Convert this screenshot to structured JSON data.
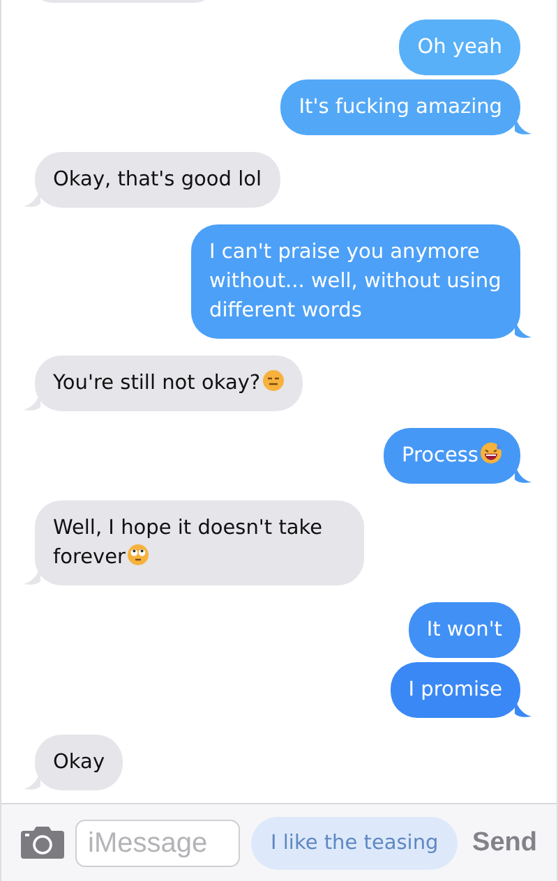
{
  "messages": [
    {
      "kind": "cut-off"
    },
    {
      "kind": "sent",
      "text": "Oh yeah",
      "tail": false
    },
    {
      "kind": "sent",
      "text": "It's fucking amazing",
      "tail": true
    },
    {
      "kind": "received",
      "text": "Okay, that's good lol",
      "tail": true
    },
    {
      "kind": "sent",
      "text": "I can't praise you anymore without... well, without using different words",
      "tail": true
    },
    {
      "kind": "received",
      "text": "You're still not okay?",
      "emoji": {
        "kind": "expressionless"
      },
      "tail": true
    },
    {
      "kind": "sent",
      "text": "Process",
      "emoji": {
        "kind": "grin-sweat"
      },
      "tail": true
    },
    {
      "kind": "received",
      "text": "Well, I hope it doesn't take forever",
      "emoji": {
        "kind": "eye-roll"
      },
      "tail": true
    },
    {
      "kind": "sent",
      "text": "It won't",
      "tail": false
    },
    {
      "kind": "sent",
      "text": "I promise",
      "tail": true
    },
    {
      "kind": "received",
      "text": "Okay",
      "tail": true
    }
  ],
  "composer": {
    "placeholder": "iMessage",
    "behind_text": "I like the teasing",
    "send": "Send"
  }
}
